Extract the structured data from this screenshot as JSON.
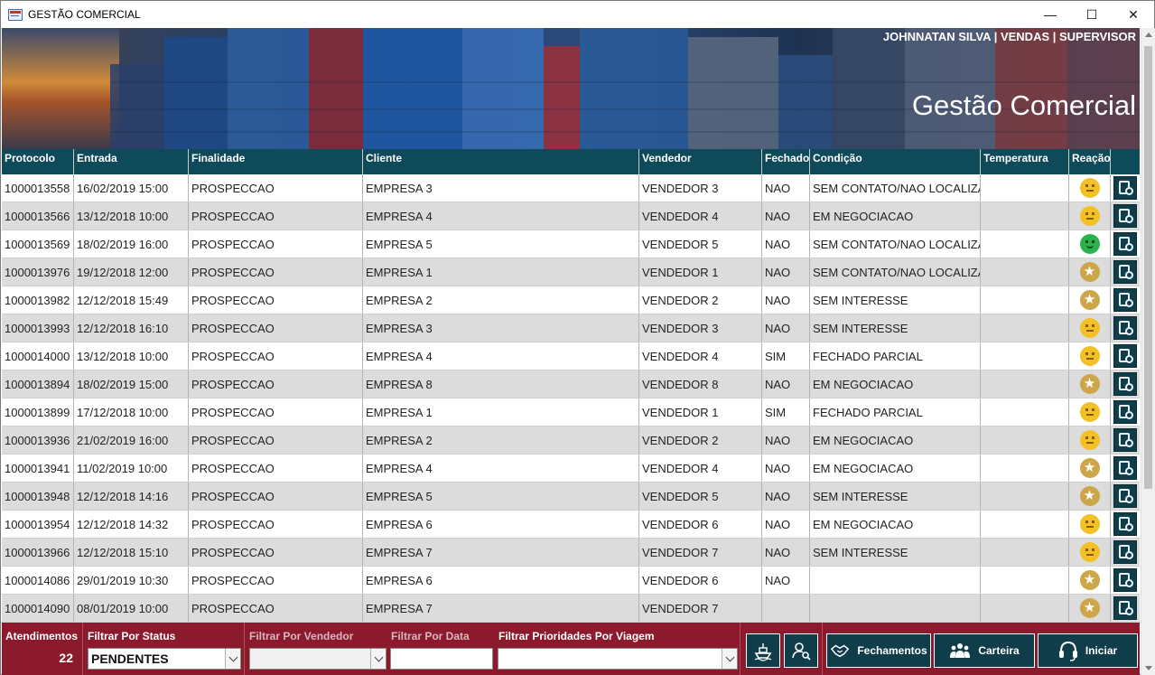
{
  "window": {
    "title": "GESTÃO COMERCIAL",
    "minimize_glyph": "—",
    "maximize_glyph": "☐",
    "close_glyph": "✕"
  },
  "banner": {
    "user": "JOHNNATAN SILVA | VENDAS | SUPERVISOR",
    "title": "Gestão Comercial"
  },
  "grid": {
    "columns": [
      "Protocolo",
      "Entrada",
      "Finalidade",
      "Cliente",
      "Vendedor",
      "Fechado",
      "Condição",
      "Temperatura",
      "Reação",
      ""
    ],
    "rows": [
      {
        "protocolo": "1000013558",
        "entrada": "16/02/2019 15:00",
        "finalidade": "PROSPECCAO",
        "cliente": "EMPRESA 3",
        "vendedor": "VENDEDOR 3",
        "fechado": "NAO",
        "condicao": "SEM CONTATO/NAO LOCALIZADO",
        "temperatura": "",
        "reacao": "neutral"
      },
      {
        "protocolo": "1000013566",
        "entrada": "13/12/2018 10:00",
        "finalidade": "PROSPECCAO",
        "cliente": "EMPRESA 4",
        "vendedor": "VENDEDOR 4",
        "fechado": "NAO",
        "condicao": "EM NEGOCIACAO",
        "temperatura": "",
        "reacao": "neutral"
      },
      {
        "protocolo": "1000013569",
        "entrada": "18/02/2019 16:00",
        "finalidade": "PROSPECCAO",
        "cliente": "EMPRESA 5",
        "vendedor": "VENDEDOR 5",
        "fechado": "NAO",
        "condicao": "SEM CONTATO/NAO LOCALIZADO",
        "temperatura": "",
        "reacao": "happy"
      },
      {
        "protocolo": "1000013976",
        "entrada": "19/12/2018 12:00",
        "finalidade": "PROSPECCAO",
        "cliente": "EMPRESA 1",
        "vendedor": "VENDEDOR 1",
        "fechado": "NAO",
        "condicao": "SEM CONTATO/NAO LOCALIZADO",
        "temperatura": "",
        "reacao": "star"
      },
      {
        "protocolo": "1000013982",
        "entrada": "12/12/2018 15:49",
        "finalidade": "PROSPECCAO",
        "cliente": "EMPRESA 2",
        "vendedor": "VENDEDOR 2",
        "fechado": "NAO",
        "condicao": "SEM INTERESSE",
        "temperatura": "",
        "reacao": "star"
      },
      {
        "protocolo": "1000013993",
        "entrada": "12/12/2018 16:10",
        "finalidade": "PROSPECCAO",
        "cliente": "EMPRESA 3",
        "vendedor": "VENDEDOR 3",
        "fechado": "NAO",
        "condicao": "SEM INTERESSE",
        "temperatura": "",
        "reacao": "neutral"
      },
      {
        "protocolo": "1000014000",
        "entrada": "13/12/2018 10:00",
        "finalidade": "PROSPECCAO",
        "cliente": "EMPRESA 4",
        "vendedor": "VENDEDOR 4",
        "fechado": "SIM",
        "condicao": "FECHADO PARCIAL",
        "temperatura": "",
        "reacao": "neutral"
      },
      {
        "protocolo": "1000013894",
        "entrada": "18/02/2019 15:00",
        "finalidade": "PROSPECCAO",
        "cliente": "EMPRESA 8",
        "vendedor": "VENDEDOR 8",
        "fechado": "NAO",
        "condicao": "EM NEGOCIACAO",
        "temperatura": "",
        "reacao": "star"
      },
      {
        "protocolo": "1000013899",
        "entrada": "17/12/2018 10:00",
        "finalidade": "PROSPECCAO",
        "cliente": "EMPRESA 1",
        "vendedor": "VENDEDOR 1",
        "fechado": "SIM",
        "condicao": "FECHADO PARCIAL",
        "temperatura": "",
        "reacao": "neutral"
      },
      {
        "protocolo": "1000013936",
        "entrada": "21/02/2019 16:00",
        "finalidade": "PROSPECCAO",
        "cliente": "EMPRESA 2",
        "vendedor": "VENDEDOR 2",
        "fechado": "NAO",
        "condicao": "EM NEGOCIACAO",
        "temperatura": "",
        "reacao": "neutral"
      },
      {
        "protocolo": "1000013941",
        "entrada": "11/02/2019 10:00",
        "finalidade": "PROSPECCAO",
        "cliente": "EMPRESA 4",
        "vendedor": "VENDEDOR 4",
        "fechado": "NAO",
        "condicao": "EM NEGOCIACAO",
        "temperatura": "",
        "reacao": "star"
      },
      {
        "protocolo": "1000013948",
        "entrada": "12/12/2018 14:16",
        "finalidade": "PROSPECCAO",
        "cliente": "EMPRESA 5",
        "vendedor": "VENDEDOR 5",
        "fechado": "NAO",
        "condicao": "SEM INTERESSE",
        "temperatura": "",
        "reacao": "star"
      },
      {
        "protocolo": "1000013954",
        "entrada": "12/12/2018 14:32",
        "finalidade": "PROSPECCAO",
        "cliente": "EMPRESA 6",
        "vendedor": "VENDEDOR 6",
        "fechado": "NAO",
        "condicao": "EM NEGOCIACAO",
        "temperatura": "",
        "reacao": "neutral"
      },
      {
        "protocolo": "1000013966",
        "entrada": "12/12/2018 15:10",
        "finalidade": "PROSPECCAO",
        "cliente": "EMPRESA 7",
        "vendedor": "VENDEDOR 7",
        "fechado": "NAO",
        "condicao": "SEM INTERESSE",
        "temperatura": "",
        "reacao": "neutral"
      },
      {
        "protocolo": "1000014086",
        "entrada": "29/01/2019 10:30",
        "finalidade": "PROSPECCAO",
        "cliente": "EMPRESA 6",
        "vendedor": "VENDEDOR 6",
        "fechado": "NAO",
        "condicao": "",
        "temperatura": "",
        "reacao": "star"
      },
      {
        "protocolo": "1000014090",
        "entrada": "08/01/2019 10:00",
        "finalidade": "PROSPECCAO",
        "cliente": "EMPRESA 7",
        "vendedor": "VENDEDOR 7",
        "fechado": "",
        "condicao": "",
        "temperatura": "",
        "reacao": "star"
      }
    ]
  },
  "footer": {
    "atendimentos_label": "Atendimentos",
    "atendimentos_count": "22",
    "status_label": "Filtrar Por Status",
    "status_value": "PENDENTES",
    "vendedor_label": "Filtrar Por Vendedor",
    "vendedor_value": "",
    "data_label": "Filtrar Por Data",
    "data_value": "",
    "viagem_label": "Filtrar Prioridades Por Viagem",
    "viagem_value": "",
    "btn_fechamentos": "Fechamentos",
    "btn_carteira": "Carteira",
    "btn_iniciar": "Iniciar"
  },
  "icons": {
    "app": "form-icon",
    "ship": "ship-icon",
    "user_search": "user-search-icon",
    "handshake": "handshake-icon",
    "group": "group-icon",
    "headset": "headset-icon",
    "row_action": "document-search-icon"
  },
  "colors": {
    "header_bg": "#0f4a5a",
    "footer_bg": "#8b1b2c",
    "button_bg": "#0f3d4a",
    "alt_row": "#dcdcdc"
  }
}
